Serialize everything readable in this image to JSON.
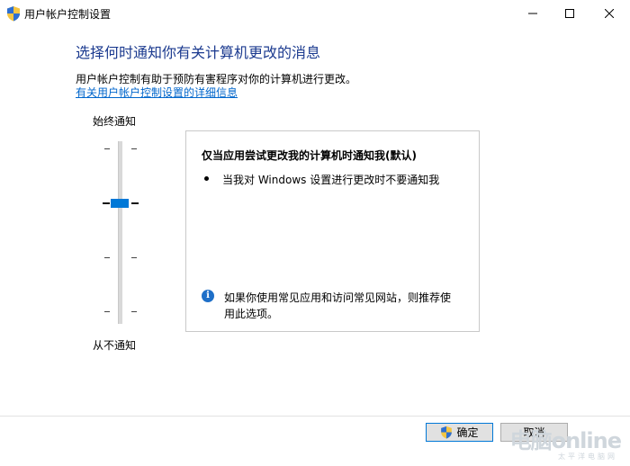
{
  "window": {
    "title": "用户帐户控制设置"
  },
  "main": {
    "heading": "选择何时通知你有关计算机更改的消息",
    "description": "用户帐户控制有助于预防有害程序对你的计算机进行更改。",
    "link": "有关用户帐户控制设置的详细信息"
  },
  "slider": {
    "top_label": "始终通知",
    "bottom_label": "从不通知",
    "levels": 4,
    "selected_level": 3
  },
  "panel": {
    "title": "仅当应用尝试更改我的计算机时通知我(默认)",
    "bullet": "当我对 Windows 设置进行更改时不要通知我",
    "info": "如果你使用常见应用和访问常见网站，则推荐使用此选项。"
  },
  "buttons": {
    "ok": "确定",
    "cancel": "取消"
  },
  "watermark": {
    "brand": "电脑online",
    "sub": "太平洋电脑网"
  },
  "colors": {
    "heading": "#1b3a8f",
    "link": "#0066cc",
    "accent": "#0078d7"
  }
}
